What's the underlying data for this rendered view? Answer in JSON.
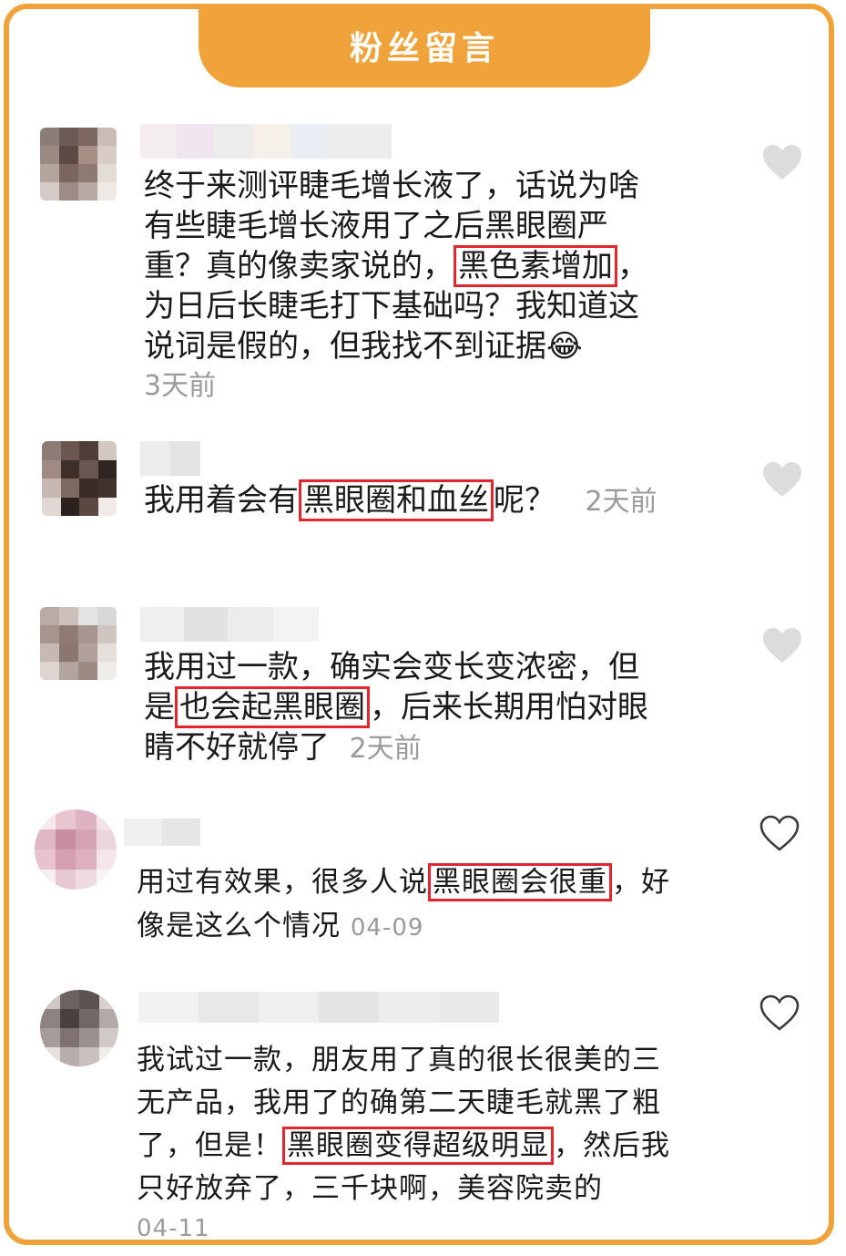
{
  "header": {
    "title": "粉丝留言"
  },
  "comments": [
    {
      "lines": [
        {
          "pre": "终于来测评睫毛增长液了，话说为啥",
          "hl": "",
          "post": ""
        },
        {
          "pre": "有些睫毛增长液用了之后黑眼圈严",
          "hl": "",
          "post": ""
        },
        {
          "pre": "重？真的像卖家说的，",
          "hl": "黑色素增加",
          "post": "，"
        },
        {
          "pre": "为日后长睫毛打下基础吗？我知道这",
          "hl": "",
          "post": ""
        },
        {
          "pre": "说词是假的，但我找不到证据",
          "hl": "",
          "post": "",
          "emoji": "😂"
        }
      ],
      "time": "3天前",
      "liked": true
    },
    {
      "lines": [
        {
          "pre": "我用着会有",
          "hl": "黑眼圈和血丝",
          "post": "呢？"
        }
      ],
      "time": "2天前",
      "liked": true
    },
    {
      "lines": [
        {
          "pre": "我用过一款，确实会变长变浓密，但",
          "hl": "",
          "post": ""
        },
        {
          "pre": "是",
          "hl": "也会起黑眼圈",
          "post": "，后来长期用怕对眼"
        },
        {
          "pre": "睛不好就停了",
          "hl": "",
          "post": ""
        }
      ],
      "time": "2天前",
      "liked": true
    },
    {
      "lines": [
        {
          "pre": "用过有效果，很多人说",
          "hl": "黑眼圈会很重",
          "post": "，好"
        },
        {
          "pre": "像是这么个情况",
          "hl": "",
          "post": ""
        }
      ],
      "time": "04-09",
      "liked": false
    },
    {
      "lines": [
        {
          "pre": "我试过一款，朋友用了真的很长很美的三",
          "hl": "",
          "post": ""
        },
        {
          "pre": "无产品，我用了的确第二天睫毛就黑了粗",
          "hl": "",
          "post": ""
        },
        {
          "pre": "了，但是！",
          "hl": "黑眼圈变得超级明显",
          "post": "，然后我"
        },
        {
          "pre": "只好放弃了，三千块啊，美容院卖的",
          "hl": "",
          "post": ""
        }
      ],
      "time": "04-11",
      "liked": false
    }
  ],
  "colors": {
    "accent": "#f0a33a",
    "highlight": "#e3262d",
    "time": "#9a9a9a"
  },
  "icons": {
    "like": "heart-icon"
  }
}
